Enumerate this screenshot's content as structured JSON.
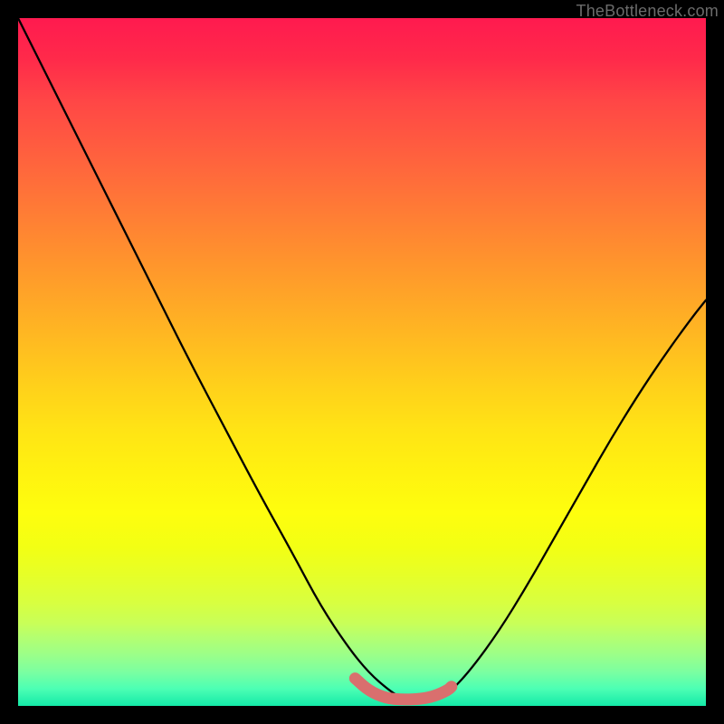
{
  "watermark": "TheBottleneck.com",
  "chart_data": {
    "type": "line",
    "title": "",
    "xlabel": "",
    "ylabel": "",
    "xlim": [
      0,
      100
    ],
    "ylim": [
      0,
      100
    ],
    "grid": false,
    "legend": false,
    "background": "vertical red-to-green gradient",
    "series": [
      {
        "name": "left-curve",
        "x": [
          0,
          5,
          10,
          15,
          20,
          25,
          30,
          35,
          40,
          44,
          48,
          51,
          54,
          56
        ],
        "values": [
          100,
          90,
          80,
          70,
          60,
          50,
          40.5,
          31,
          22,
          14.5,
          8.5,
          4.8,
          2.2,
          1.0
        ]
      },
      {
        "name": "right-curve",
        "x": [
          61,
          63,
          66,
          70,
          74,
          78,
          82,
          86,
          90,
          94,
          98,
          100
        ],
        "values": [
          1.0,
          2.2,
          5.5,
          11,
          17.5,
          24.5,
          31.5,
          38.5,
          45,
          51,
          56.5,
          59
        ]
      },
      {
        "name": "highlight-band",
        "x": [
          49,
          51,
          53.5,
          56,
          58.5,
          60.5,
          62.5,
          63
        ],
        "values": [
          4.0,
          2.2,
          1.1,
          0.9,
          1.0,
          1.4,
          2.3,
          2.8
        ]
      }
    ],
    "highlight_color": "#d96f6e"
  }
}
